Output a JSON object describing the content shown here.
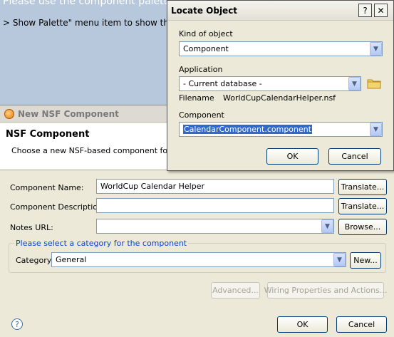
{
  "background": {
    "line1": "Please use the component palette",
    "line2": "> Show Palette\" menu item to show the"
  },
  "nsf": {
    "title": "New NSF Component",
    "heading": "NSF Component",
    "description": "Choose a new NSF-based component for use",
    "component_name_label": "Component Name:",
    "component_name_value": "WorldCup Calendar Helper",
    "component_desc_label": "Component Description:",
    "component_desc_value": "",
    "notes_url_label": "Notes URL:",
    "notes_url_value": "",
    "translate_label": "Translate...",
    "translate2_label": "Translate...",
    "browse_label": "Browse...",
    "group_legend": "Please select a category for the component",
    "category_label": "Category",
    "category_value": "General",
    "new_label": "New...",
    "advanced_label": "Advanced...",
    "wiring_label": "Wiring Properties and Actions...",
    "ok_label": "OK",
    "cancel_label": "Cancel",
    "help_glyph": "?"
  },
  "locate": {
    "title": "Locate Object",
    "help_glyph": "?",
    "close_glyph": "✕",
    "kind_label": "Kind of object",
    "kind_value": "Component",
    "application_label": "Application",
    "application_value": "- Current database -",
    "filename_label": "Filename",
    "filename_value": "WorldCupCalendarHelper.nsf",
    "component_label": "Component",
    "component_value": "CalendarComponent.component",
    "ok_label": "OK",
    "cancel_label": "Cancel"
  },
  "icons": {
    "dropdown": "chevron-down-icon",
    "folder": "folder-icon",
    "help": "help-icon",
    "title": "component-icon"
  }
}
